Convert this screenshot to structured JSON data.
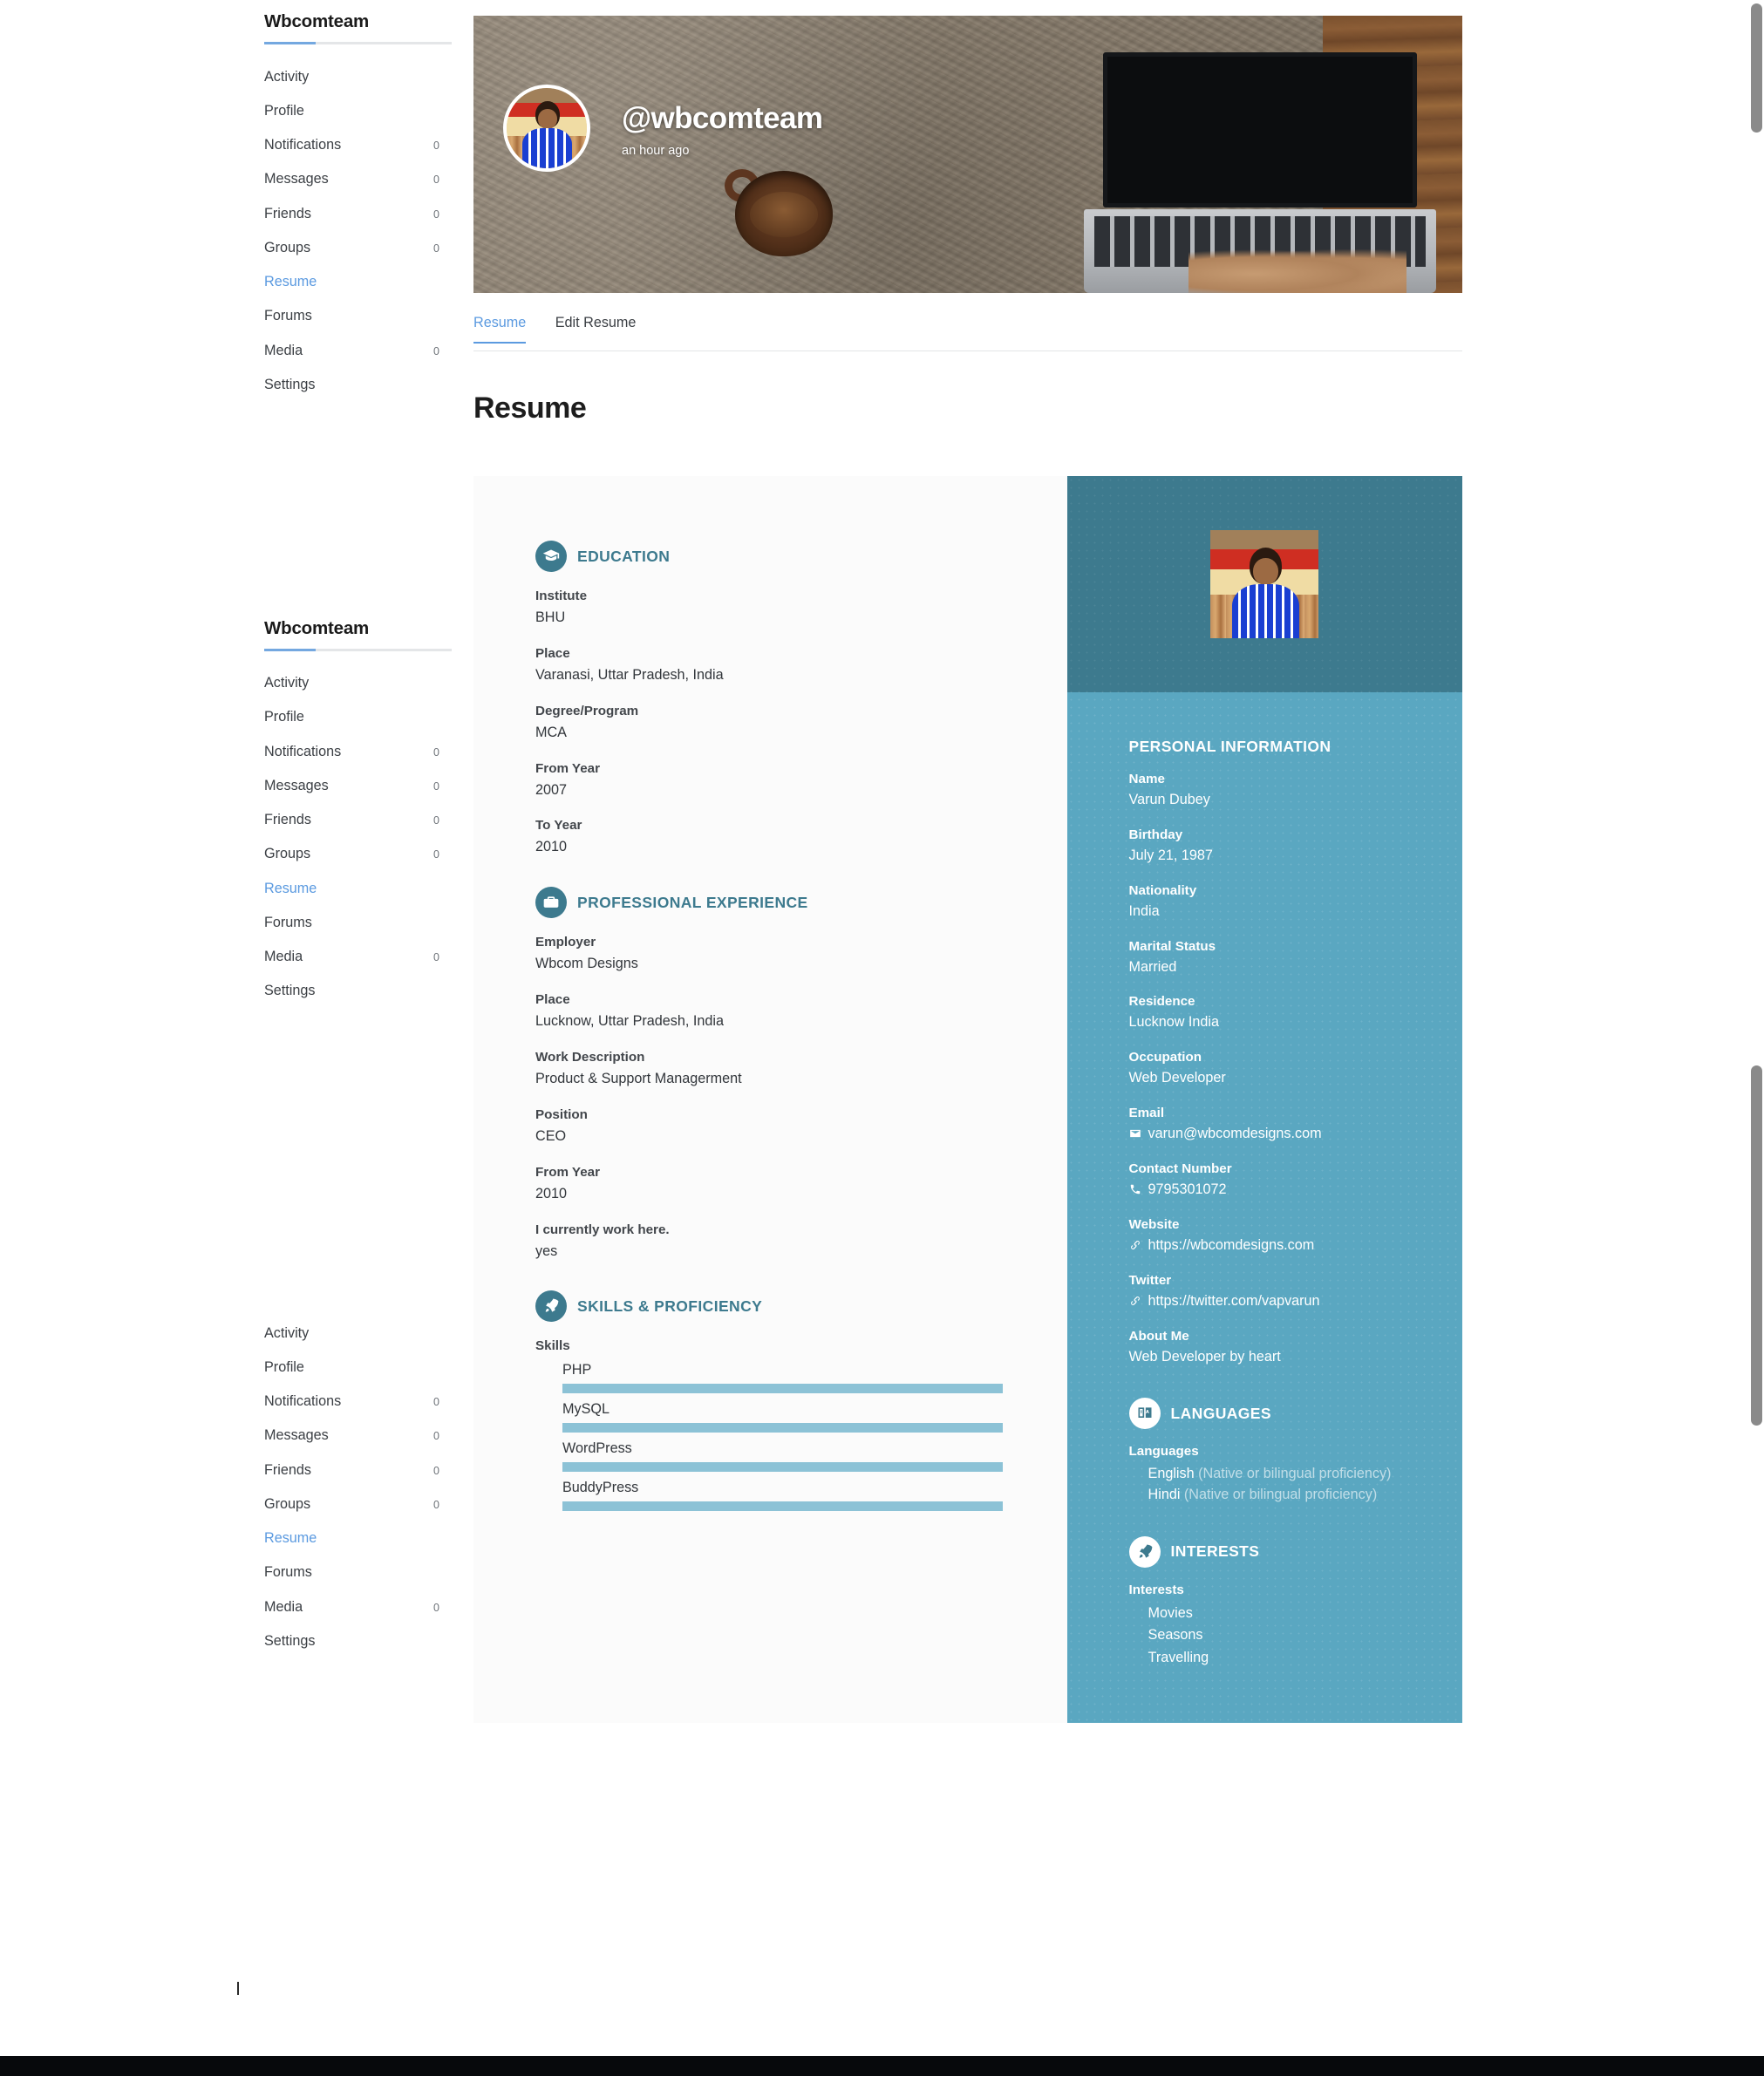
{
  "sidebar": {
    "heading": "Wbcomteam",
    "items": [
      {
        "label": "Activity",
        "count": "",
        "active": false
      },
      {
        "label": "Profile",
        "count": "",
        "active": false
      },
      {
        "label": "Notifications",
        "count": "0",
        "active": false
      },
      {
        "label": "Messages",
        "count": "0",
        "active": false
      },
      {
        "label": "Friends",
        "count": "0",
        "active": false
      },
      {
        "label": "Groups",
        "count": "0",
        "active": false
      },
      {
        "label": "Resume",
        "count": "",
        "active": true
      },
      {
        "label": "Forums",
        "count": "",
        "active": false
      },
      {
        "label": "Media",
        "count": "0",
        "active": false
      },
      {
        "label": "Settings",
        "count": "",
        "active": false
      }
    ]
  },
  "cover": {
    "username": "@wbcomteam",
    "time_ago": "an hour ago"
  },
  "tabs": [
    {
      "label": "Resume",
      "active": true
    },
    {
      "label": "Edit Resume",
      "active": false
    }
  ],
  "page_title": "Resume",
  "education": {
    "section_title": "EDUCATION",
    "icon": "graduation-cap-icon",
    "fields": [
      {
        "label": "Institute",
        "value": "BHU"
      },
      {
        "label": "Place",
        "value": "Varanasi, Uttar Pradesh, India"
      },
      {
        "label": "Degree/Program",
        "value": "MCA"
      },
      {
        "label": "From Year",
        "value": "2007"
      },
      {
        "label": "To Year",
        "value": "2010"
      }
    ]
  },
  "experience": {
    "section_title": "PROFESSIONAL EXPERIENCE",
    "icon": "briefcase-icon",
    "fields": [
      {
        "label": "Employer",
        "value": "Wbcom Designs"
      },
      {
        "label": "Place",
        "value": "Lucknow, Uttar Pradesh, India"
      },
      {
        "label": "Work Description",
        "value": "Product & Support Managerment"
      },
      {
        "label": "Position",
        "value": "CEO"
      },
      {
        "label": "From Year",
        "value": "2010"
      },
      {
        "label": "I currently work here.",
        "value": "yes"
      }
    ]
  },
  "skills": {
    "section_title": "SKILLS & PROFICIENCY",
    "icon": "rocket-icon",
    "group_label": "Skills",
    "items": [
      {
        "name": "PHP",
        "percent": 100
      },
      {
        "name": "MySQL",
        "percent": 100
      },
      {
        "name": "WordPress",
        "percent": 100
      },
      {
        "name": "BuddyPress",
        "percent": 100
      }
    ]
  },
  "personal": {
    "section_title": "PERSONAL INFORMATION",
    "fields": [
      {
        "label": "Name",
        "value": "Varun Dubey",
        "icon": ""
      },
      {
        "label": "Birthday",
        "value": "July 21, 1987",
        "icon": ""
      },
      {
        "label": "Nationality",
        "value": "India",
        "icon": ""
      },
      {
        "label": "Marital Status",
        "value": "Married",
        "icon": ""
      },
      {
        "label": "Residence",
        "value": "Lucknow India",
        "icon": ""
      },
      {
        "label": "Occupation",
        "value": "Web Developer",
        "icon": ""
      },
      {
        "label": "Email",
        "value": "varun@wbcomdesigns.com",
        "icon": "envelope-icon"
      },
      {
        "label": "Contact Number",
        "value": "9795301072",
        "icon": "phone-icon"
      },
      {
        "label": "Website",
        "value": "https://wbcomdesigns.com",
        "icon": "link-icon"
      },
      {
        "label": "Twitter",
        "value": "https://twitter.com/vapvarun",
        "icon": "link-icon"
      },
      {
        "label": "About Me",
        "value": "Web Developer by heart",
        "icon": ""
      }
    ]
  },
  "languages": {
    "section_title": "LANGUAGES",
    "icon": "translate-icon",
    "group_label": "Languages",
    "items": [
      {
        "name": "English",
        "proficiency": "(Native or bilingual proficiency)"
      },
      {
        "name": "Hindi",
        "proficiency": "(Native or bilingual proficiency)"
      }
    ]
  },
  "interests": {
    "section_title": "INTERESTS",
    "icon": "rocket-icon",
    "group_label": "Interests",
    "items": [
      "Movies",
      "Seasons",
      "Travelling"
    ]
  },
  "colors": {
    "accent_blue": "#5b9ae0",
    "panel_teal": "#5aa7c1",
    "panel_teal_dark": "#3d7a8e",
    "skill_bar": "#8cc2d6"
  }
}
